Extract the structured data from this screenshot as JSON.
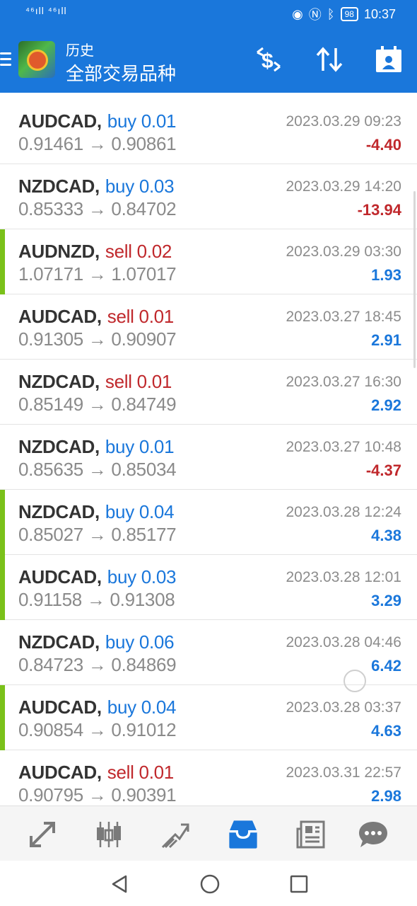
{
  "status_bar": {
    "left_text": "⁴⁶ıll ⁴⁶ıll",
    "battery": "98",
    "time": "10:37"
  },
  "header": {
    "title_small": "历史",
    "title_big": "全部交易品种"
  },
  "trades": [
    {
      "symbol": "AUDCAD,",
      "side": "buy 0.01",
      "side_type": "buy",
      "prices": "0.91461 → 0.90861",
      "time": "2023.03.29 09:23",
      "profit": "-4.40",
      "marked": false
    },
    {
      "symbol": "NZDCAD,",
      "side": "buy 0.03",
      "side_type": "buy",
      "prices": "0.85333 → 0.84702",
      "time": "2023.03.29 14:20",
      "profit": "-13.94",
      "marked": false
    },
    {
      "symbol": "AUDNZD,",
      "side": "sell 0.02",
      "side_type": "sell",
      "prices": "1.07171 → 1.07017",
      "time": "2023.03.29 03:30",
      "profit": "1.93",
      "marked": true
    },
    {
      "symbol": "AUDCAD,",
      "side": "sell 0.01",
      "side_type": "sell",
      "prices": "0.91305 → 0.90907",
      "time": "2023.03.27 18:45",
      "profit": "2.91",
      "marked": false
    },
    {
      "symbol": "NZDCAD,",
      "side": "sell 0.01",
      "side_type": "sell",
      "prices": "0.85149 → 0.84749",
      "time": "2023.03.27 16:30",
      "profit": "2.92",
      "marked": false
    },
    {
      "symbol": "NZDCAD,",
      "side": "buy 0.01",
      "side_type": "buy",
      "prices": "0.85635 → 0.85034",
      "time": "2023.03.27 10:48",
      "profit": "-4.37",
      "marked": false
    },
    {
      "symbol": "NZDCAD,",
      "side": "buy 0.04",
      "side_type": "buy",
      "prices": "0.85027 → 0.85177",
      "time": "2023.03.28 12:24",
      "profit": "4.38",
      "marked": true
    },
    {
      "symbol": "AUDCAD,",
      "side": "buy 0.03",
      "side_type": "buy",
      "prices": "0.91158 → 0.91308",
      "time": "2023.03.28 12:01",
      "profit": "3.29",
      "marked": true
    },
    {
      "symbol": "NZDCAD,",
      "side": "buy 0.06",
      "side_type": "buy",
      "prices": "0.84723 → 0.84869",
      "time": "2023.03.28 04:46",
      "profit": "6.42",
      "marked": false
    },
    {
      "symbol": "AUDCAD,",
      "side": "buy 0.04",
      "side_type": "buy",
      "prices": "0.90854 → 0.91012",
      "time": "2023.03.28 03:37",
      "profit": "4.63",
      "marked": true
    },
    {
      "symbol": "AUDCAD,",
      "side": "sell 0.01",
      "side_type": "sell",
      "prices": "0.90795 → 0.90391",
      "time": "2023.03.31 22:57",
      "profit": "2.98",
      "marked": false
    }
  ],
  "bottom_nav": [
    {
      "icon": "quotes-icon",
      "active": false
    },
    {
      "icon": "chart-icon",
      "active": false
    },
    {
      "icon": "trade-icon",
      "active": false
    },
    {
      "icon": "history-icon",
      "active": true
    },
    {
      "icon": "news-icon",
      "active": false
    },
    {
      "icon": "chat-icon",
      "active": false
    }
  ],
  "colors": {
    "accent": "#1a77db",
    "loss": "#c0282c",
    "marker": "#7ac11a",
    "inactive_icon": "#7a7a7a"
  }
}
